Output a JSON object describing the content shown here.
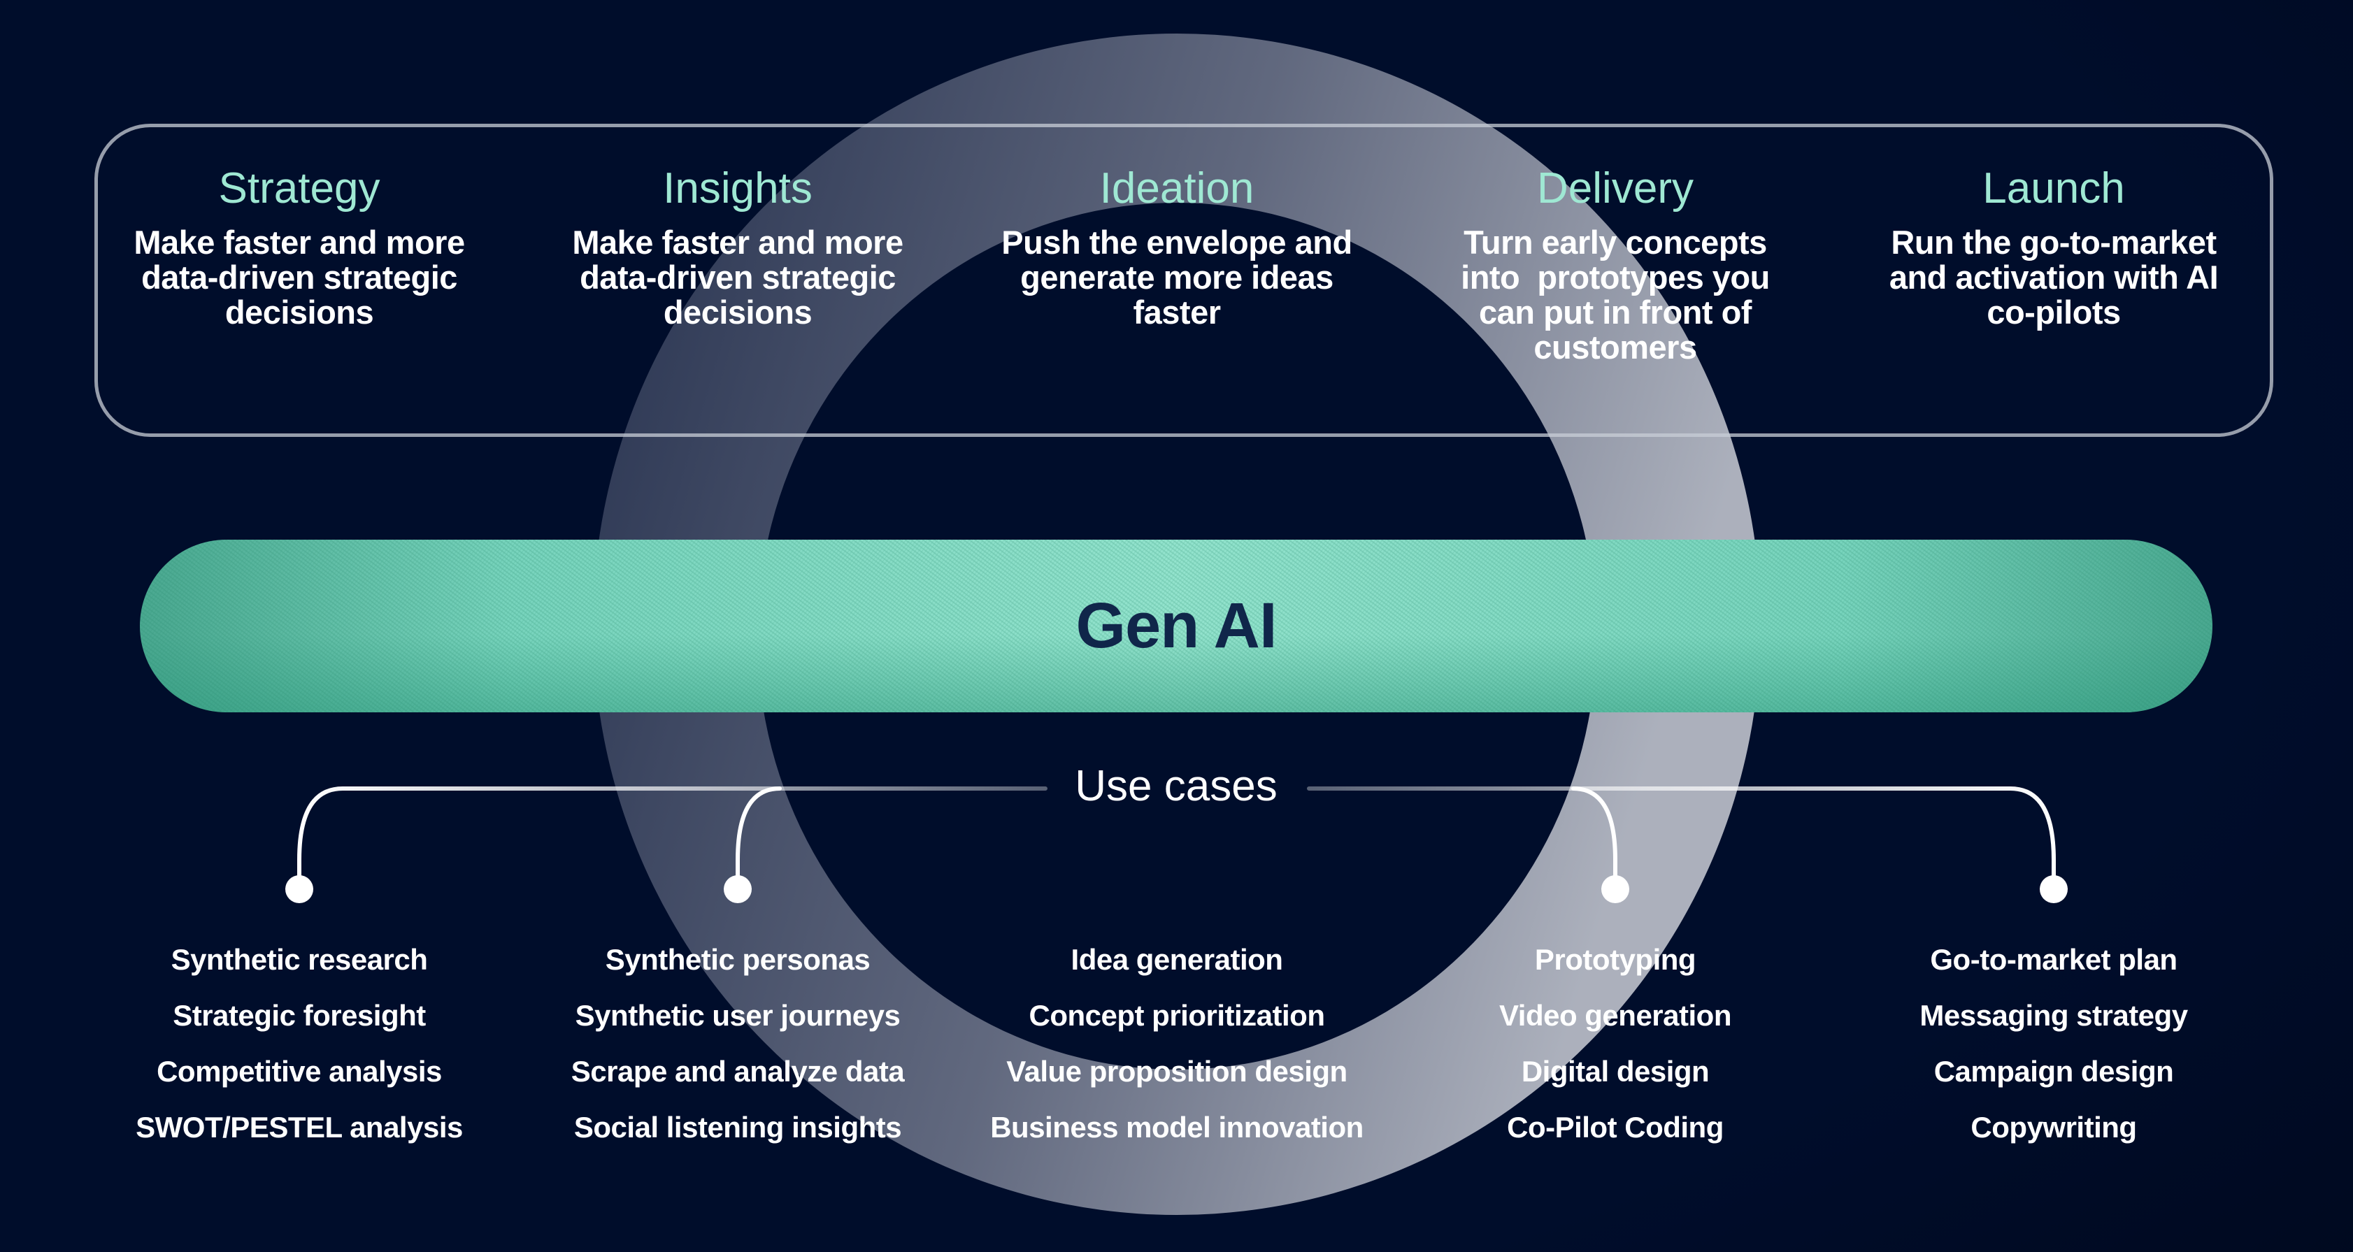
{
  "colors": {
    "background": "#000d2b",
    "phase_title": "#9fe8d3",
    "text": "#ffffff",
    "genai_bar": "#93e3cd",
    "genai_text": "#10264a"
  },
  "phases": [
    {
      "title": "Strategy",
      "desc": [
        "Make faster and more",
        "data-driven strategic",
        "decisions"
      ]
    },
    {
      "title": "Insights",
      "desc": [
        "Make faster and more",
        "data-driven strategic",
        "decisions"
      ]
    },
    {
      "title": "Ideation",
      "desc": [
        "Push the envelope and",
        "generate more ideas",
        "faster"
      ]
    },
    {
      "title": "Delivery",
      "desc": [
        "Turn early concepts",
        "into  prototypes you",
        "can put in front of",
        "customers"
      ]
    },
    {
      "title": "Launch",
      "desc": [
        "Run the go-to-market",
        "and activation with AI",
        "co-pilots"
      ]
    }
  ],
  "center": {
    "label": "Gen AI"
  },
  "use_cases": {
    "label": "Use cases",
    "columns": [
      [
        "Synthetic research",
        "Strategic foresight",
        "Competitive analysis",
        "SWOT/PESTEL analysis"
      ],
      [
        "Synthetic personas",
        "Synthetic user journeys",
        "Scrape and analyze data",
        "Social listening insights"
      ],
      [
        "Idea generation",
        "Concept prioritization",
        "Value proposition design",
        "Business model innovation"
      ],
      [
        "Prototyping",
        "Video generation",
        "Digital design",
        "Co-Pilot Coding"
      ],
      [
        "Go-to-market plan",
        "Messaging strategy",
        "Campaign design",
        "Copywriting"
      ]
    ]
  }
}
